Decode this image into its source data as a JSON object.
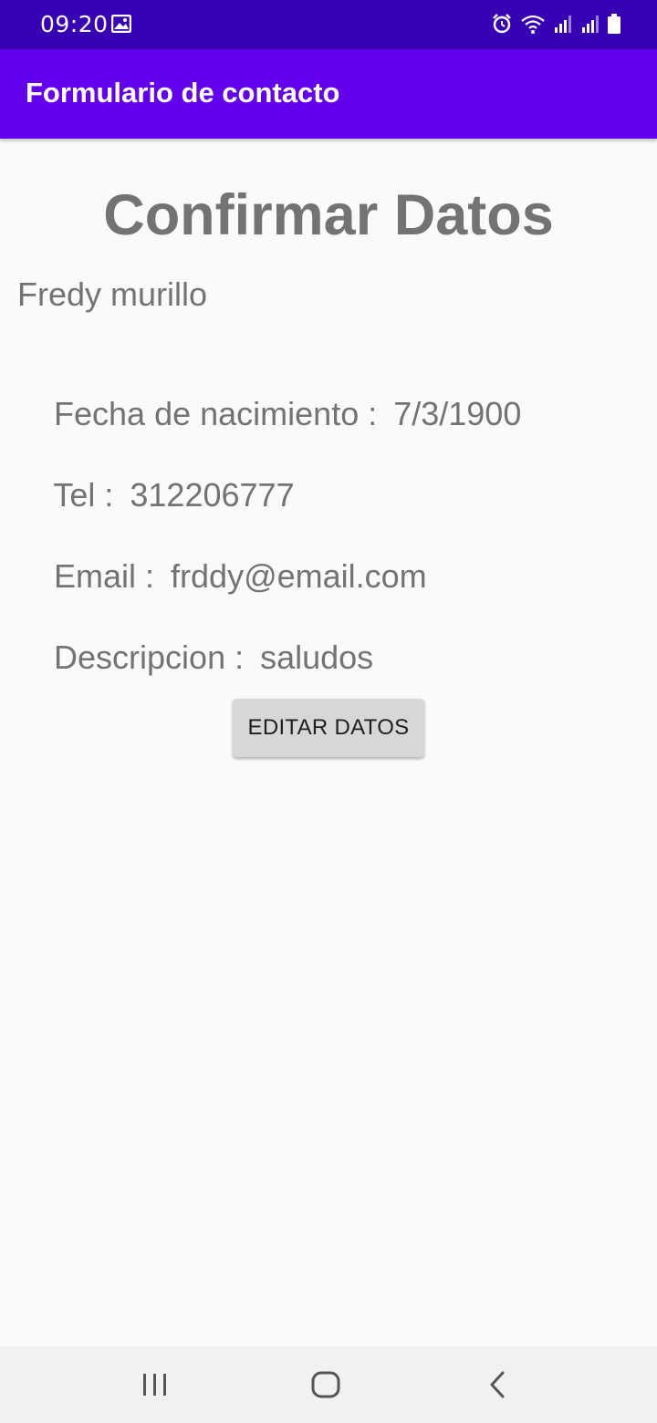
{
  "status_bar": {
    "time": "09:20",
    "icons_left": [
      "image-icon"
    ],
    "icons_right": [
      "alarm-icon",
      "wifi-icon",
      "signal-icon",
      "signal-icon",
      "battery-icon"
    ]
  },
  "app_bar": {
    "title": "Formulario de contacto",
    "color": "#6200ee"
  },
  "main": {
    "heading": "Confirmar Datos",
    "name": "Fredy murillo",
    "fields": [
      {
        "label": "Fecha de nacimiento :",
        "value": "7/3/1900"
      },
      {
        "label": "Tel :",
        "value": "312206777"
      },
      {
        "label": "Email :",
        "value": "frddy@email.com"
      },
      {
        "label": "Descripcion :",
        "value": "saludos"
      }
    ],
    "edit_button_label": "EDITAR DATOS"
  },
  "nav_bar": {
    "buttons": [
      "recents-icon",
      "home-icon",
      "back-icon"
    ]
  }
}
